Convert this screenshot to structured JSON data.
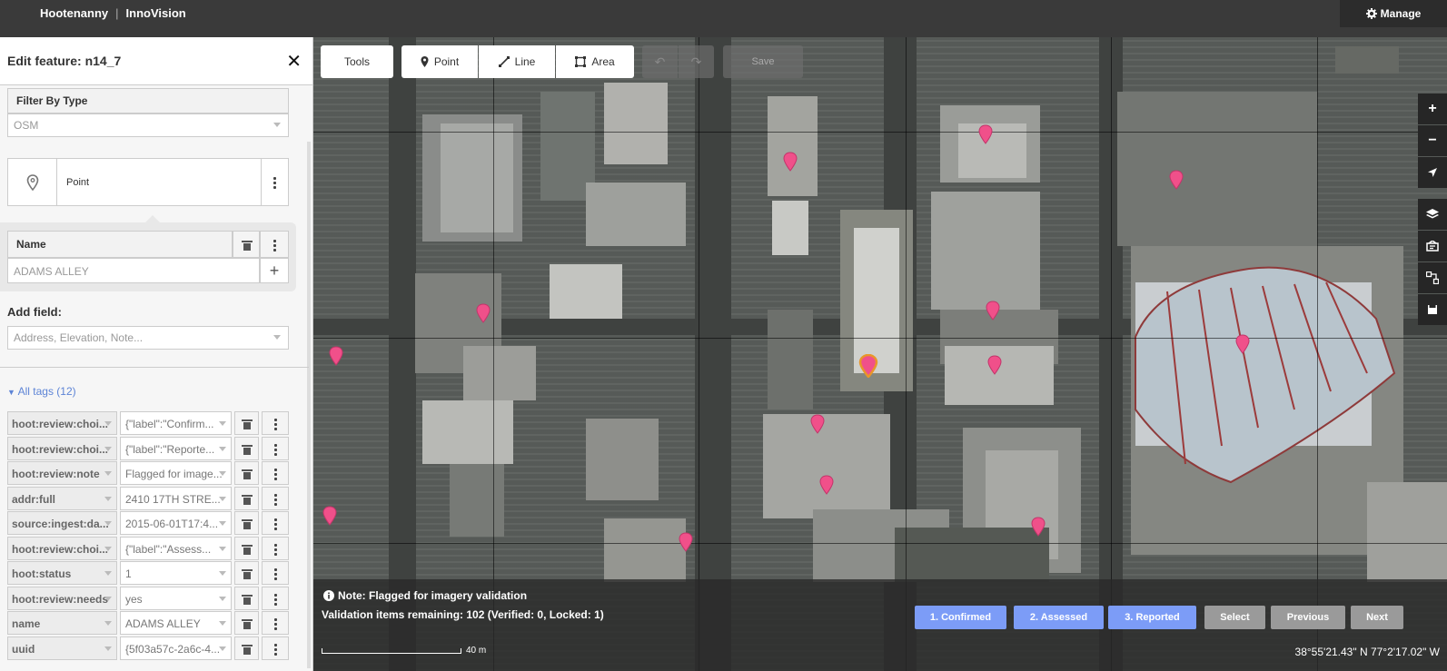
{
  "header": {
    "app_name": "Hootenanny",
    "separator": "|",
    "project_name": "InnoVision",
    "manage_label": "Manage"
  },
  "sidebar": {
    "title": "Edit feature: n14_7",
    "filter_label": "Filter By Type",
    "filter_value": "OSM",
    "preset_label": "Point",
    "name_label": "Name",
    "name_value": "ADAMS ALLEY",
    "add_field_label": "Add field:",
    "add_field_placeholder": "Address, Elevation, Note...",
    "all_tags_label": "All tags (12)",
    "tags": [
      {
        "key": "hoot:review:choi...",
        "value": "{\"label\":\"Confirm..."
      },
      {
        "key": "hoot:review:choi...",
        "value": "{\"label\":\"Reporte..."
      },
      {
        "key": "hoot:review:note",
        "value": "Flagged for image..."
      },
      {
        "key": "addr:full",
        "value": "2410 17TH STRE..."
      },
      {
        "key": "source:ingest:da...",
        "value": "2015-06-01T17:4..."
      },
      {
        "key": "hoot:review:choi...",
        "value": "{\"label\":\"Assess..."
      },
      {
        "key": "hoot:status",
        "value": "1"
      },
      {
        "key": "hoot:review:needs",
        "value": "yes"
      },
      {
        "key": "name",
        "value": "ADAMS ALLEY"
      },
      {
        "key": "uuid",
        "value": "{5f03a57c-2a6c-4..."
      }
    ]
  },
  "toolbar": {
    "tools_label": "Tools",
    "point_label": "Point",
    "line_label": "Line",
    "area_label": "Area",
    "save_label": "Save"
  },
  "footer": {
    "note": "Note: Flagged for imagery validation",
    "remaining": "Validation items remaining: 102 (Verified: 0, Locked: 1)",
    "buttons": {
      "confirmed": "1. Confirmed",
      "assessed": "2. Assessed",
      "reported": "3. Reported",
      "select": "Select",
      "previous": "Previous",
      "next": "Next"
    },
    "scale_label": "40 m",
    "coordinates": "38°55'21.43\" N 77°2'17.02\" W"
  },
  "colors": {
    "pin": "#f0508a",
    "selected_pin_outline": "#e8962a",
    "review_button": "#7c9cf7",
    "nav_button": "#9a9a9a"
  }
}
